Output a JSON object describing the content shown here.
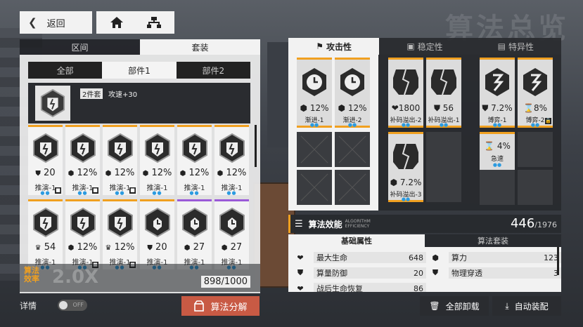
{
  "background_title": "算法总览",
  "nav": {
    "back_label": "返回"
  },
  "left_tabs": [
    "区间",
    "套装"
  ],
  "sub_tabs": [
    "全部",
    "部件1",
    "部件2"
  ],
  "set_card": {
    "tag": "2件套",
    "desc": "攻速+30"
  },
  "chips": [
    {
      "val": "20",
      "name": "推演-1",
      "icon": "shield-crack-icon",
      "stat": "hp-shield",
      "lock": true
    },
    {
      "val": "12%",
      "name": "推演-1",
      "icon": "shield-crack-icon",
      "stat": "hex",
      "lock": true
    },
    {
      "val": "12%",
      "name": "推演-1",
      "icon": "shield-crack-icon",
      "stat": "hex",
      "lock": true
    },
    {
      "val": "12%",
      "name": "推演-1",
      "icon": "shield-crack-icon",
      "stat": "hex",
      "lock": false
    },
    {
      "val": "12%",
      "name": "推演-1",
      "icon": "shield-crack-icon",
      "stat": "hex",
      "lock": false
    },
    {
      "val": "12%",
      "name": "推演-1",
      "icon": "shield-crack-icon",
      "stat": "hex",
      "lock": false
    },
    {
      "val": "54",
      "name": "推演-1",
      "icon": "shield-crack-icon",
      "stat": "crown",
      "lock": false
    },
    {
      "val": "12%",
      "name": "推演-1",
      "icon": "shield-crack-icon",
      "stat": "hex",
      "lock": true
    },
    {
      "val": "12%",
      "name": "推演-1",
      "icon": "shield-crack-icon",
      "stat": "crown",
      "lock": true
    },
    {
      "val": "20",
      "name": "推演-1",
      "icon": "shield-clock-icon",
      "stat": "shield",
      "lock": false
    },
    {
      "val": "27",
      "name": "推演-1",
      "icon": "shield-clock-icon",
      "stat": "hex",
      "lock": false,
      "purple": true
    },
    {
      "val": "27",
      "name": "推演-1",
      "icon": "shield-clock-icon",
      "stat": "hex",
      "lock": false,
      "purple": true
    }
  ],
  "capacity": {
    "label_line1": "算法",
    "label_line2": "效率",
    "big": "2.0X",
    "value": "898/1000"
  },
  "details": {
    "label": "详情",
    "toggle": "OFF"
  },
  "decompose_label": "算法分解",
  "right_tabs": [
    "攻击性",
    "稳定性",
    "特异性"
  ],
  "slots": {
    "g1": [
      {
        "val": "12%",
        "name": "渐进-1"
      },
      {
        "val": "12%",
        "name": "渐进-2"
      }
    ],
    "g2": [
      {
        "val": "1800",
        "name": "补码溢出-2"
      },
      {
        "val": "56",
        "name": "补码溢出-1"
      },
      {
        "val": "7.2%",
        "name": "补码溢出-3"
      }
    ],
    "g3": [
      {
        "val": "7.2%",
        "name": "博弈-1"
      },
      {
        "val": "8%",
        "name": "博弈-2"
      },
      {
        "val": "4%",
        "name": "急速"
      }
    ]
  },
  "efficiency": {
    "title": "算法效能",
    "sub": "ALGORITHM EFFICIENCY",
    "value": "446",
    "max": "/1976"
  },
  "attr_tabs": [
    "基础属性",
    "算法套装"
  ],
  "attrs": [
    {
      "label": "最大生命",
      "value": "648"
    },
    {
      "label": "算力",
      "value": "123"
    },
    {
      "label": "算量防御",
      "value": "20"
    },
    {
      "label": "物理穿透",
      "value": "3"
    },
    {
      "label": "战后生命恢复",
      "value": "86"
    }
  ],
  "actions": {
    "unload_all": "全部卸载",
    "auto_equip": "自动装配"
  }
}
